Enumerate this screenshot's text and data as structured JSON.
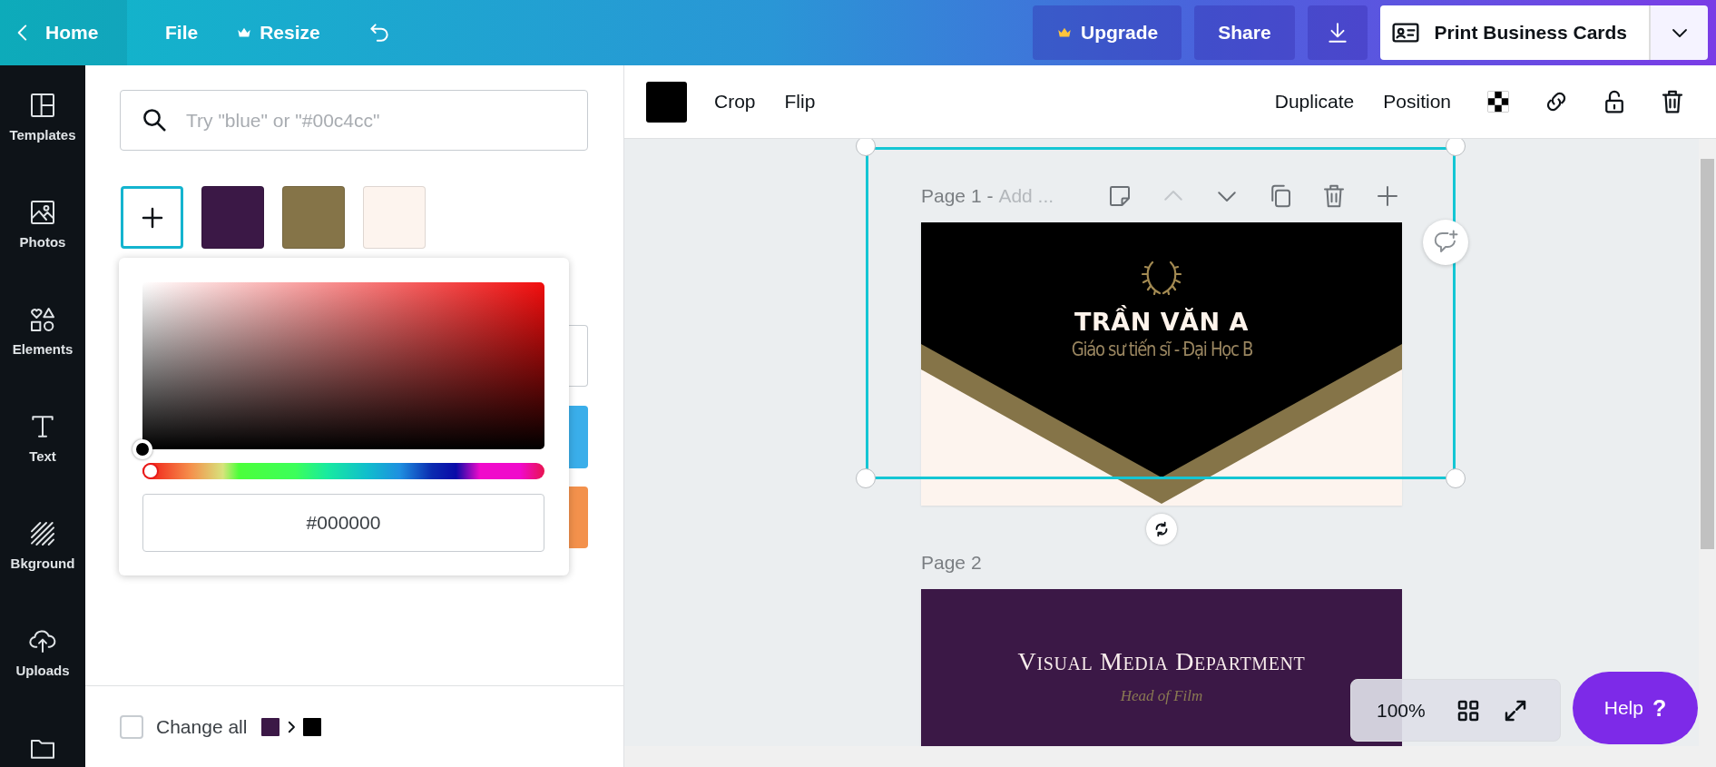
{
  "top_bar": {
    "home": "Home",
    "menu": [
      {
        "kind": "text",
        "label": "File"
      },
      {
        "kind": "crown",
        "label": "Resize"
      },
      {
        "kind": "undo"
      }
    ],
    "upgrade": "Upgrade",
    "share": "Share",
    "print": "Print Business Cards"
  },
  "sidebar": {
    "items": [
      {
        "kind": "templates",
        "label": "Templates",
        "selected": false
      },
      {
        "kind": "photos",
        "label": "Photos",
        "selected": false
      },
      {
        "kind": "elements",
        "label": "Elements",
        "selected": false
      },
      {
        "kind": "text",
        "label": "Text",
        "selected": false
      },
      {
        "kind": "background",
        "label": "Bkground",
        "selected": false
      },
      {
        "kind": "uploads",
        "label": "Uploads",
        "selected": false
      },
      {
        "kind": "folder",
        "selected": false
      }
    ]
  },
  "color_panel": {
    "search": {
      "placeholder": "Try \"blue\" or \"#00c4cc\""
    },
    "add_color": {
      "focused": true
    },
    "swatches": [
      {
        "color": "#3b1846"
      },
      {
        "color": "#857448"
      },
      {
        "color": "#fdf4ee"
      }
    ],
    "hue_slider": {
      "level": 0
    },
    "hex": "#000000",
    "change_all": {
      "label": "Change all",
      "checked": false,
      "swatches": [
        {
          "color": "#3b1846"
        },
        {
          "color": "#000000"
        }
      ]
    }
  },
  "toolbar": {
    "color": "#000000",
    "left_buttons": [
      {
        "kind": "text",
        "label": "Crop"
      },
      {
        "kind": "text",
        "label": "Flip"
      }
    ],
    "right_buttons": [
      {
        "kind": "text",
        "label": "Duplicate"
      },
      {
        "kind": "text",
        "label": "Position"
      },
      {
        "kind": "transparency"
      },
      {
        "kind": "link"
      },
      {
        "kind": "lock"
      },
      {
        "kind": "trash"
      }
    ]
  },
  "pages": [
    {
      "kind": "business_card",
      "label": "Page 1 -",
      "title": "Add ...",
      "selected": true,
      "name": "TRẦN VĂN A",
      "subtitle": "Giáo sư tiến sĩ - Đại Học B",
      "actions": [
        {
          "kind": "note",
          "disabled": false
        },
        {
          "kind": "up",
          "disabled": true
        },
        {
          "kind": "down",
          "disabled": false
        },
        {
          "kind": "copy",
          "disabled": false
        },
        {
          "kind": "trash",
          "disabled": false
        },
        {
          "kind": "plus",
          "disabled": false
        }
      ]
    },
    {
      "kind": "department_card",
      "label": "Page 2",
      "selected": false,
      "name": "Visual Media Department",
      "subtitle": "Head of Film"
    }
  ],
  "zoom": {
    "value": "100%"
  },
  "help": {
    "label": "Help",
    "icon": "?"
  }
}
